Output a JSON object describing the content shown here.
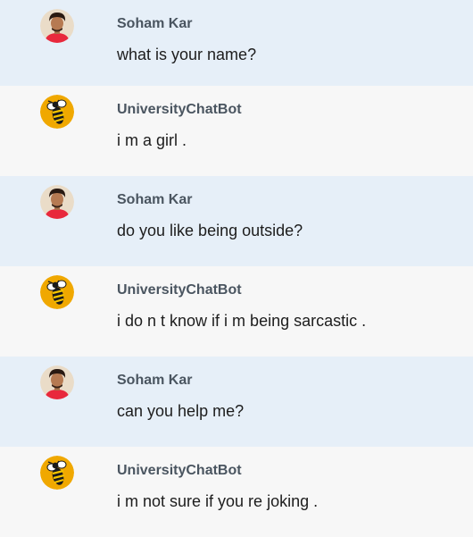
{
  "messages": [
    {
      "role": "user",
      "sender": "Soham Kar",
      "text": "what is your name?",
      "avatar": "user-photo-icon"
    },
    {
      "role": "bot",
      "sender": "UniversityChatBot",
      "text": "i m a girl .",
      "avatar": "bee-mascot-icon"
    },
    {
      "role": "user",
      "sender": "Soham Kar",
      "text": "do you like being outside?",
      "avatar": "user-photo-icon"
    },
    {
      "role": "bot",
      "sender": "UniversityChatBot",
      "text": "i do n t know if i m being sarcastic .",
      "avatar": "bee-mascot-icon"
    },
    {
      "role": "user",
      "sender": "Soham Kar",
      "text": "can you help me?",
      "avatar": "user-photo-icon"
    },
    {
      "role": "bot",
      "sender": "UniversityChatBot",
      "text": "i m not sure if you re joking .",
      "avatar": "bee-mascot-icon"
    }
  ],
  "colors": {
    "user_row_bg": "#e6eff8",
    "bot_row_bg": "#f7f7f7",
    "name_text": "#4a5560",
    "message_text": "#1d1d1d",
    "bot_avatar_bg": "#f0a800",
    "user_shirt": "#e8283c"
  }
}
